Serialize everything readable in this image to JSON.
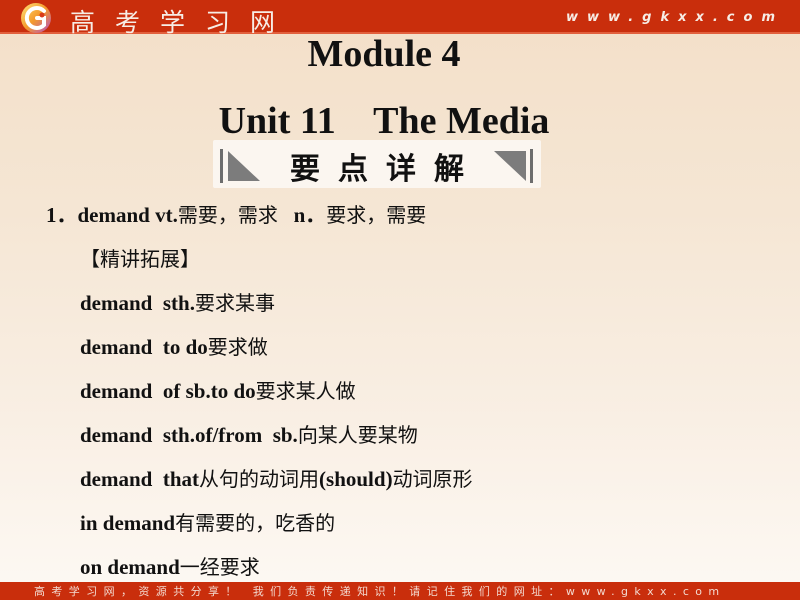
{
  "header": {
    "brand_name": "高考学习网",
    "brand_url": "www.gkxx.com",
    "logo_icon": "gkxx-logo-icon",
    "colors": {
      "bar": "#c92e0c",
      "text": "#f7ede6"
    }
  },
  "slide": {
    "module_title": "Module 4",
    "unit_title": "Unit 11    The Media",
    "section_banner": "要点详解"
  },
  "entries": [
    {
      "number": "1．",
      "headword": "demand vt.",
      "definition_cn": "需要，需求",
      "pos2": "   n．",
      "definition2_cn": "要求，需要"
    }
  ],
  "expansion": {
    "heading": "【精讲拓展】",
    "phrases": [
      {
        "en": "demand  sth.",
        "cn": "要求某事"
      },
      {
        "en": "demand  to do",
        "cn": "要求做"
      },
      {
        "en": "demand  of sb.to do",
        "cn": "要求某人做"
      },
      {
        "en": "demand  sth.of/from  sb.",
        "cn": "向某人要某物"
      },
      {
        "en": "demand  that",
        "cn": "从句的动词用",
        "en2": "(should)",
        "cn2": "动词原形"
      },
      {
        "en": "in demand",
        "cn": "有需要的，吃香的"
      },
      {
        "en": "on demand",
        "cn": "一经要求"
      }
    ]
  },
  "footer": {
    "text": "高考学习网，资源共分享！ 我们负责传递知识！请记住我们的网址：www.gkxx.com"
  }
}
